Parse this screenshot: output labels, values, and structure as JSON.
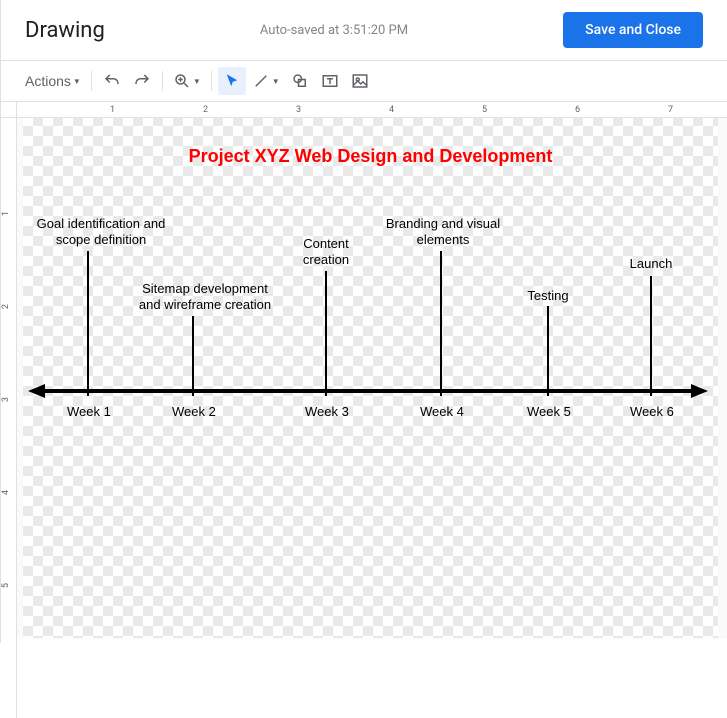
{
  "header": {
    "title": "Drawing",
    "autosave": "Auto-saved at 3:51:20 PM",
    "save_button": "Save and Close"
  },
  "toolbar": {
    "actions": "Actions"
  },
  "ruler": {
    "h_marks": [
      "1",
      "2",
      "3",
      "4",
      "5",
      "6",
      "7"
    ],
    "v_marks": [
      "1",
      "2",
      "3",
      "4",
      "5"
    ]
  },
  "drawing": {
    "title": "Project XYZ Web Design and Development",
    "milestones": [
      {
        "label": "Goal identification and scope definition",
        "week": "Week 1"
      },
      {
        "label": "Sitemap development and wireframe creation",
        "week": "Week 2"
      },
      {
        "label": "Content creation",
        "week": "Week 3"
      },
      {
        "label": "Branding and visual elements",
        "week": "Week 4"
      },
      {
        "label": "Testing",
        "week": "Week 5"
      },
      {
        "label": "Launch",
        "week": "Week 6"
      }
    ]
  }
}
